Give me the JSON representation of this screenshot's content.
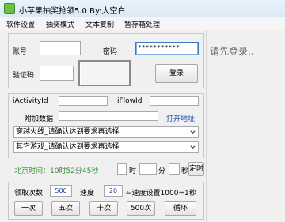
{
  "window": {
    "title": "小苹果抽奖抢领5.0 By:大空白"
  },
  "menu": [
    "软件设置",
    "抽奖模式",
    "文本复制",
    "暂存箱处理"
  ],
  "login": {
    "account_label": "账号",
    "password_label": "密码",
    "password_value": "***********",
    "captcha_label": "验证码",
    "login_button": "登录"
  },
  "params": {
    "activity_label": "iActivityId",
    "flow_label": "iFlowId",
    "extra_label": "附加数据",
    "open_link": "打开地址",
    "select1": "穿越火线_请确认达到要求再选择",
    "select2": "其它游戏_请确认达到要求再选择"
  },
  "timer": {
    "beijing_time": "北京时间：10时52分45秒",
    "hour_label": "时",
    "minute_label": "分",
    "second_label": "秒",
    "timed_button": "定时"
  },
  "draw": {
    "count_label": "领取次数",
    "count_value": "500",
    "speed_label": "速度",
    "speed_value": "20",
    "speed_hint": "←速度设置1000=1秒",
    "buttons": [
      "一次",
      "五次",
      "十次",
      "500次",
      "循环"
    ]
  },
  "status": {
    "message": "请先登录.."
  }
}
